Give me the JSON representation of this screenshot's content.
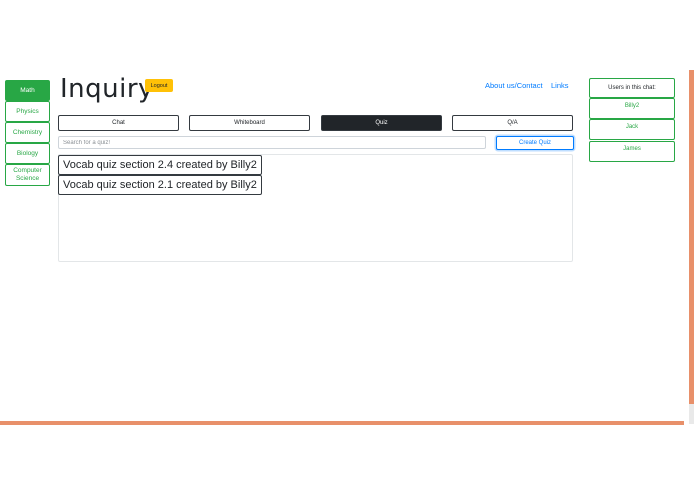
{
  "app": {
    "title": "Inquiry",
    "logout_label": "Logout"
  },
  "nav_links": [
    "About us/Contact",
    "Links"
  ],
  "subjects": [
    {
      "label": "Math",
      "active": true
    },
    {
      "label": "Physics",
      "active": false
    },
    {
      "label": "Chemistry",
      "active": false
    },
    {
      "label": "Biology",
      "active": false
    },
    {
      "label": "Computer Science",
      "active": false
    }
  ],
  "tabs": [
    {
      "label": "Chat",
      "active": false
    },
    {
      "label": "Whiteboard",
      "active": false
    },
    {
      "label": "Quiz",
      "active": true
    },
    {
      "label": "Q/A",
      "active": false
    }
  ],
  "search": {
    "placeholder": "Search for a quiz!",
    "value": ""
  },
  "create_quiz_label": "Create Quiz",
  "quizzes": [
    "Vocab quiz section 2.4 created by Billy2",
    "Vocab quiz section 2.1 created by Billy2"
  ],
  "users_panel": {
    "heading": "Users in this chat:",
    "users": [
      "Billy2",
      "Jack",
      "James"
    ]
  },
  "colors": {
    "accent_green": "#28a745",
    "logout_yellow": "#ffc107",
    "link_blue": "#007bff",
    "tab_dark": "#212529",
    "edge_orange": "#e8906a"
  }
}
